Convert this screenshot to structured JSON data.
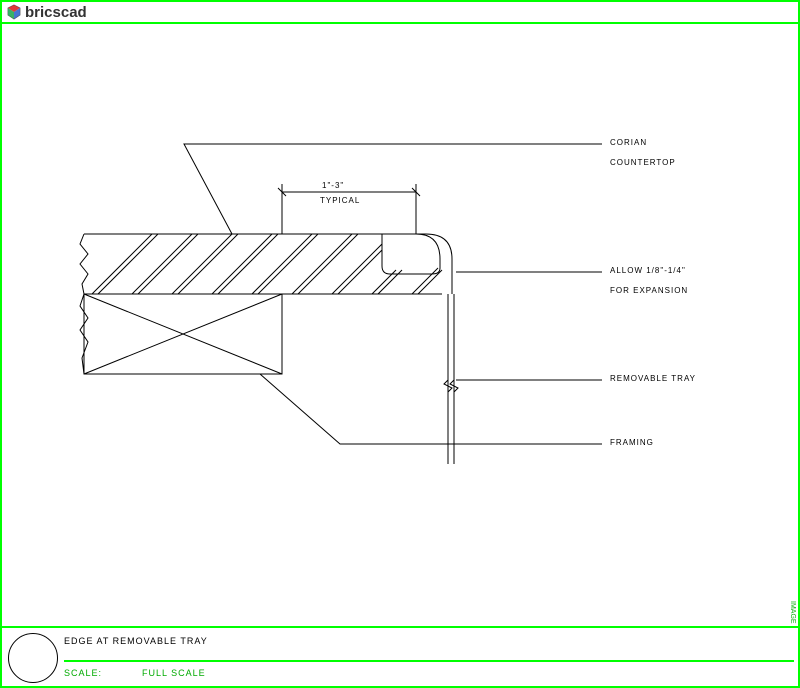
{
  "app": {
    "name": "bricscad"
  },
  "drawing": {
    "dimension": {
      "value": "1\"-3\"",
      "note": "TYPICAL"
    },
    "callouts": {
      "corian": {
        "l1": "CORIAN",
        "l2": "COUNTERTOP"
      },
      "expansion": {
        "l1": "ALLOW 1/8\"-1/4\"",
        "l2": "FOR EXPANSION"
      },
      "tray": "REMOVABLE TRAY",
      "framing": "FRAMING"
    }
  },
  "titleblock": {
    "title": "EDGE AT REMOVABLE TRAY",
    "scale_label": "SCALE:",
    "scale_value": "FULL SCALE"
  },
  "side_tag": "IMAGE"
}
